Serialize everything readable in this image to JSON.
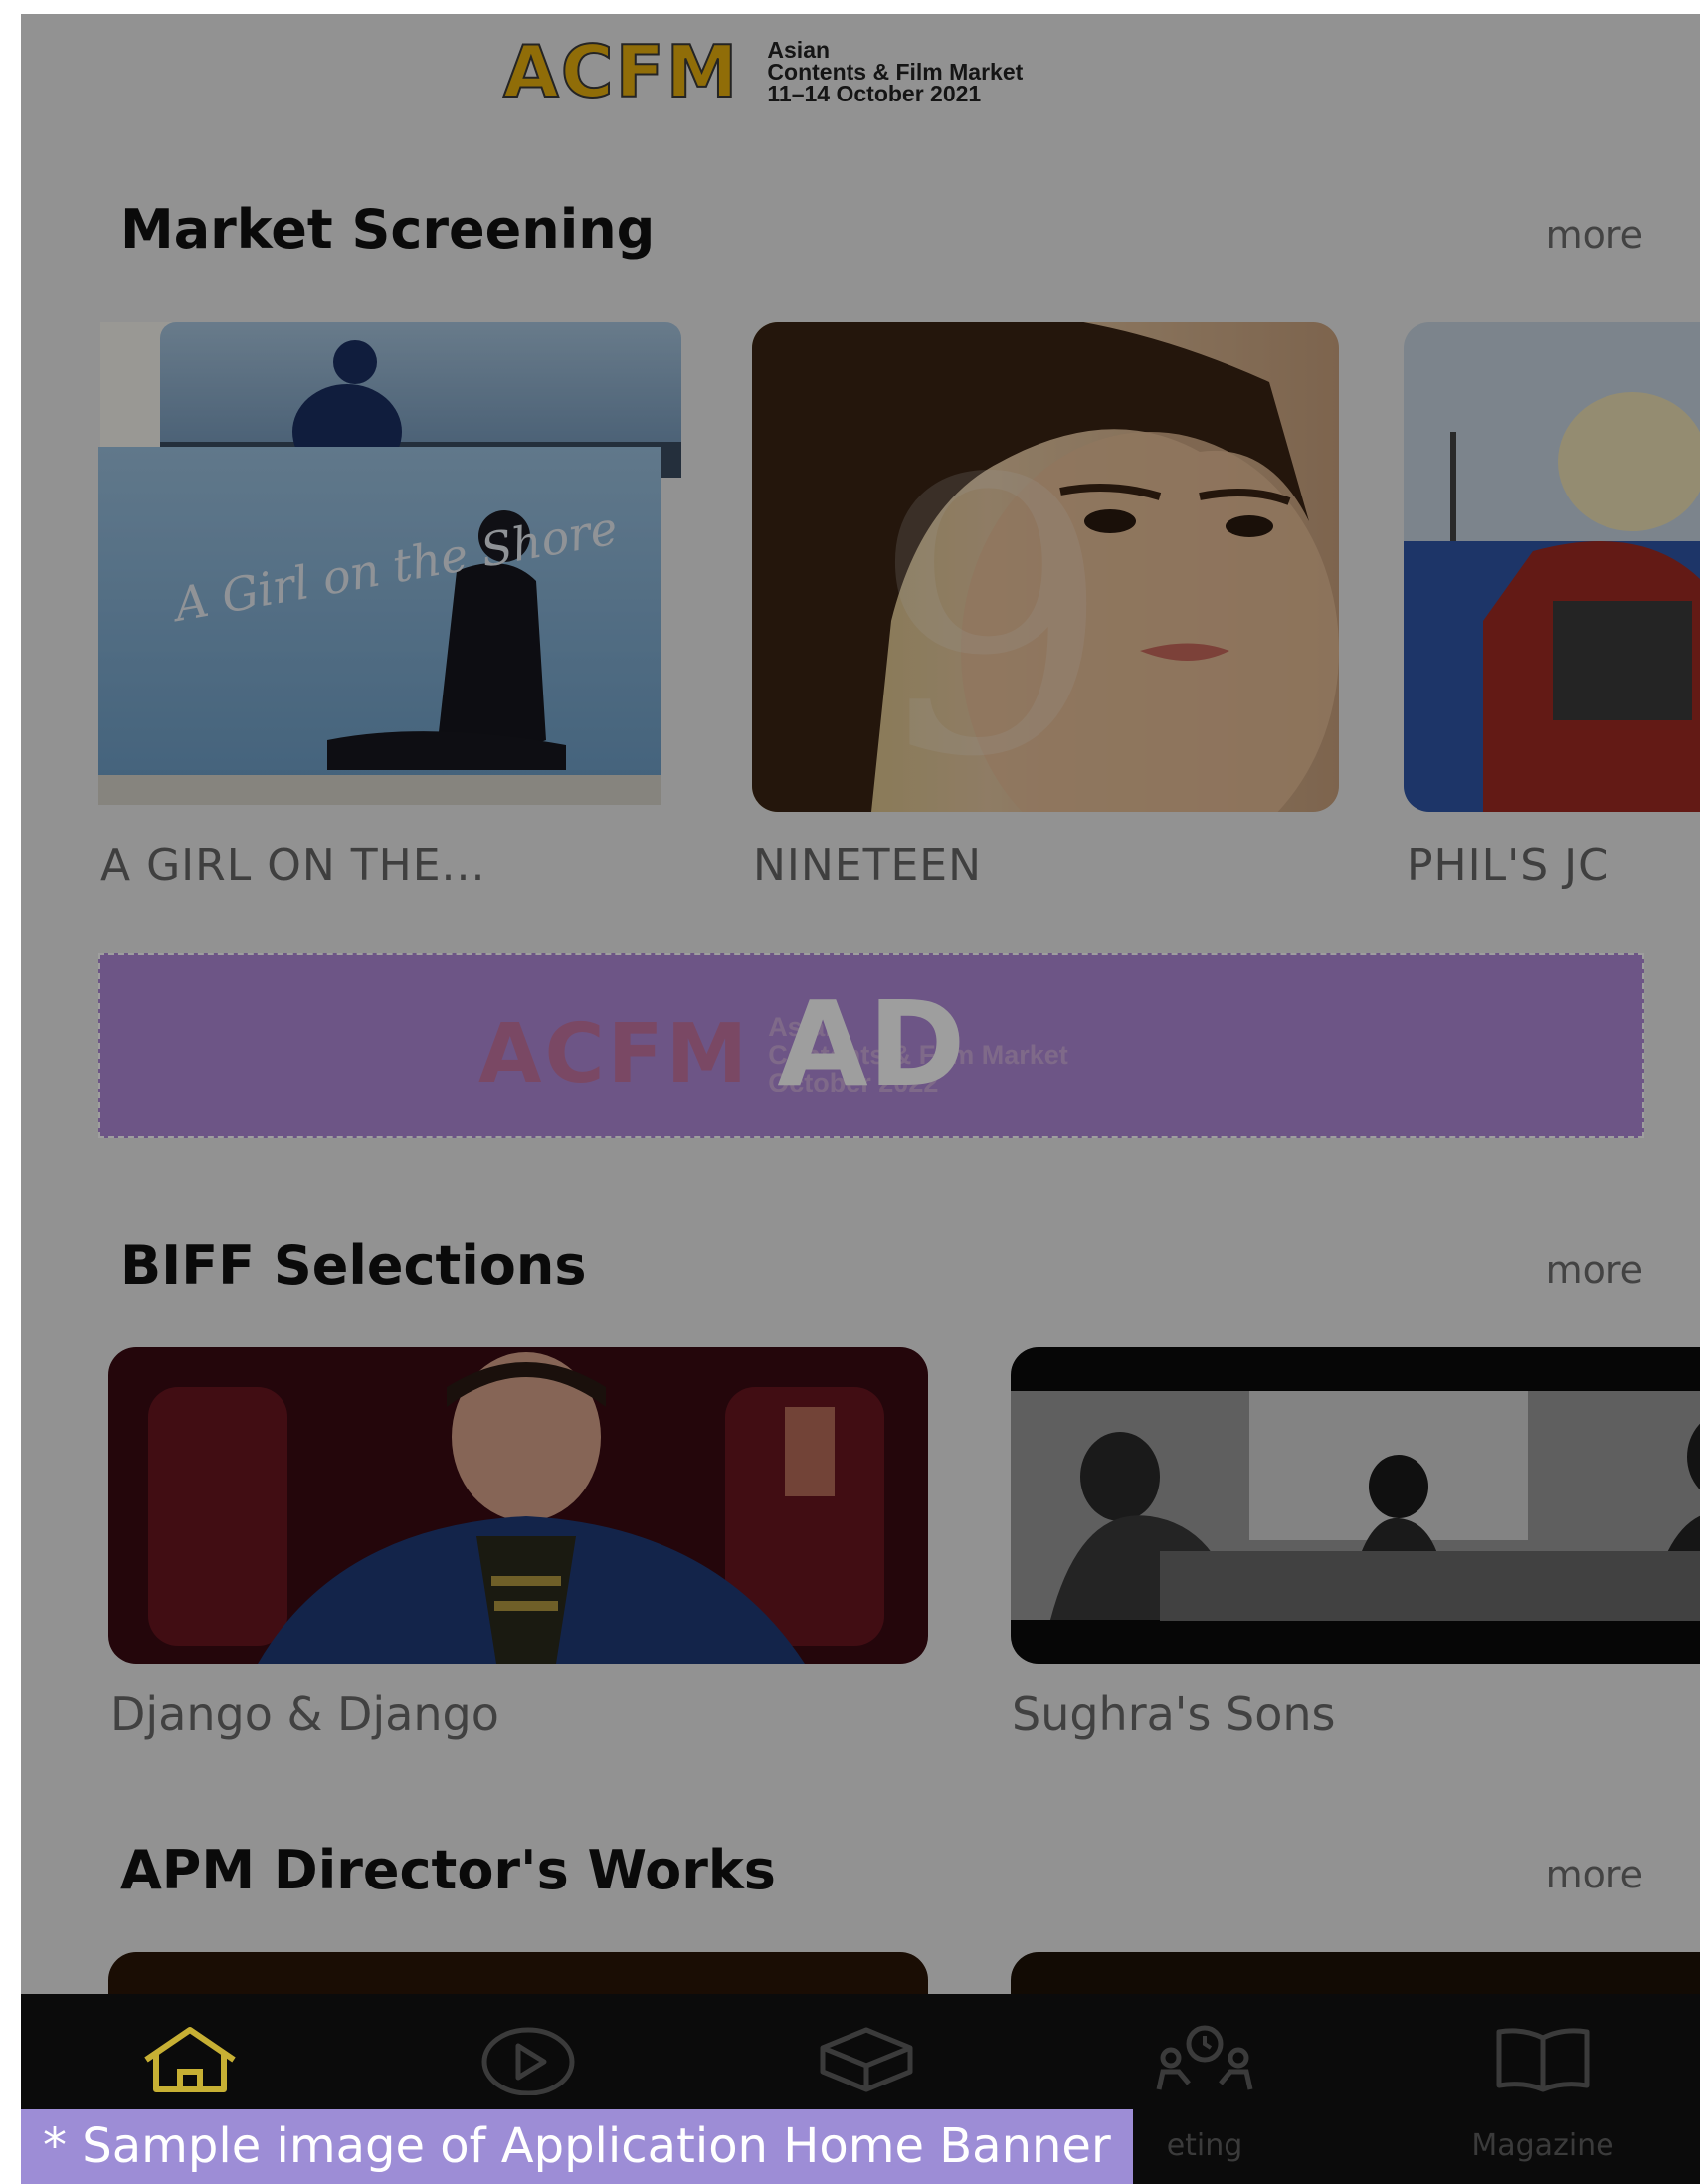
{
  "header": {
    "logo_mark": "ACFM",
    "logo_line1": "Asian",
    "logo_line2": "Contents & Film Market",
    "logo_line3": "11–14 October 2021"
  },
  "sections": {
    "market_screening": {
      "title": "Market Screening",
      "more": "more",
      "items": [
        {
          "title": "A GIRL ON THE...",
          "poster_text": "A Girl on the Shore"
        },
        {
          "title": "NINETEEN"
        },
        {
          "title": "PHIL'S JC"
        }
      ]
    },
    "biff_selections": {
      "title": "BIFF Selections",
      "more": "more",
      "items": [
        {
          "title": "Django & Django"
        },
        {
          "title": "Sughra's Sons"
        }
      ]
    },
    "apm_directors_works": {
      "title": "APM Director's Works",
      "more": "more"
    }
  },
  "ad": {
    "label": "AD",
    "ghost_mark": "ACFM",
    "ghost_line1": "Asian",
    "ghost_line2": "Contents & Film Market",
    "ghost_line3": "October 2022"
  },
  "nav": {
    "items": [
      {
        "label": "",
        "icon": "home-icon"
      },
      {
        "label": "",
        "icon": "play-icon"
      },
      {
        "label": "",
        "icon": "box-icon"
      },
      {
        "label": "eting",
        "icon": "meeting-icon"
      },
      {
        "label": "Magazine",
        "icon": "book-icon"
      }
    ],
    "active_color": "#c7b034"
  },
  "caption": "* Sample image of Application Home Banner"
}
